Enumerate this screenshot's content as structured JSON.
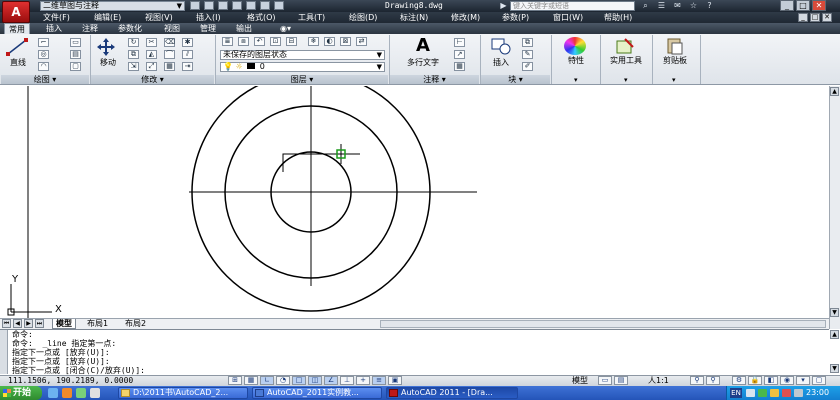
{
  "app": {
    "workspace": "二维草图与注释",
    "doc_title": "Drawing8.dwg",
    "search_placeholder": "键入关键字或短语",
    "logo": "A"
  },
  "menu": {
    "items": [
      "文件(F)",
      "编辑(E)",
      "视图(V)",
      "插入(I)",
      "格式(O)",
      "工具(T)",
      "绘图(D)",
      "标注(N)",
      "修改(M)",
      "参数(P)",
      "窗口(W)",
      "帮助(H)"
    ]
  },
  "ribbon": {
    "tabs": [
      "常用",
      "插入",
      "注释",
      "参数化",
      "视图",
      "管理",
      "输出"
    ],
    "tools": {
      "line": "直线",
      "move": "移动",
      "multiline_text": "多行文字",
      "insert": "插入",
      "properties": "特性",
      "utilities": "实用工具",
      "clipboard": "剪贴板"
    },
    "layer_state": "未保存的图层状态",
    "layer_current": "0",
    "panels": {
      "draw": "绘图",
      "modify": "修改",
      "layers": "图层",
      "annotation": "注释",
      "block": "块"
    }
  },
  "drawing": {
    "ucs_y": "Y",
    "ucs_x": "X",
    "circle_radii_px": null
  },
  "layout_tabs": [
    "模型",
    "布局1",
    "布局2"
  ],
  "command": {
    "lines": [
      "命令:",
      "命令:  _line 指定第一点:",
      "指定下一点或 [放弃(U)]:",
      "指定下一点或 [放弃(U)]:",
      "指定下一点或 [闭合(C)/放弃(U)]:"
    ]
  },
  "status": {
    "coords": "111.1506, 190.2189, 0.0000",
    "model": "模型",
    "scale": "人1:1"
  },
  "taskbar": {
    "start": "开始",
    "tasks": [
      "D:\\2011书\\AutoCAD_2...",
      "AutoCAD_2011实例教...",
      "AutoCAD 2011 - [Dra..."
    ],
    "lang": "EN",
    "clock": "23:00"
  },
  "colors": {
    "title_bg": "#1c2530",
    "accent_red": "#c01818",
    "taskbar_blue": "#2454b8",
    "start_green": "#2f8a2f",
    "snap_marker": "#1a9a1a"
  }
}
